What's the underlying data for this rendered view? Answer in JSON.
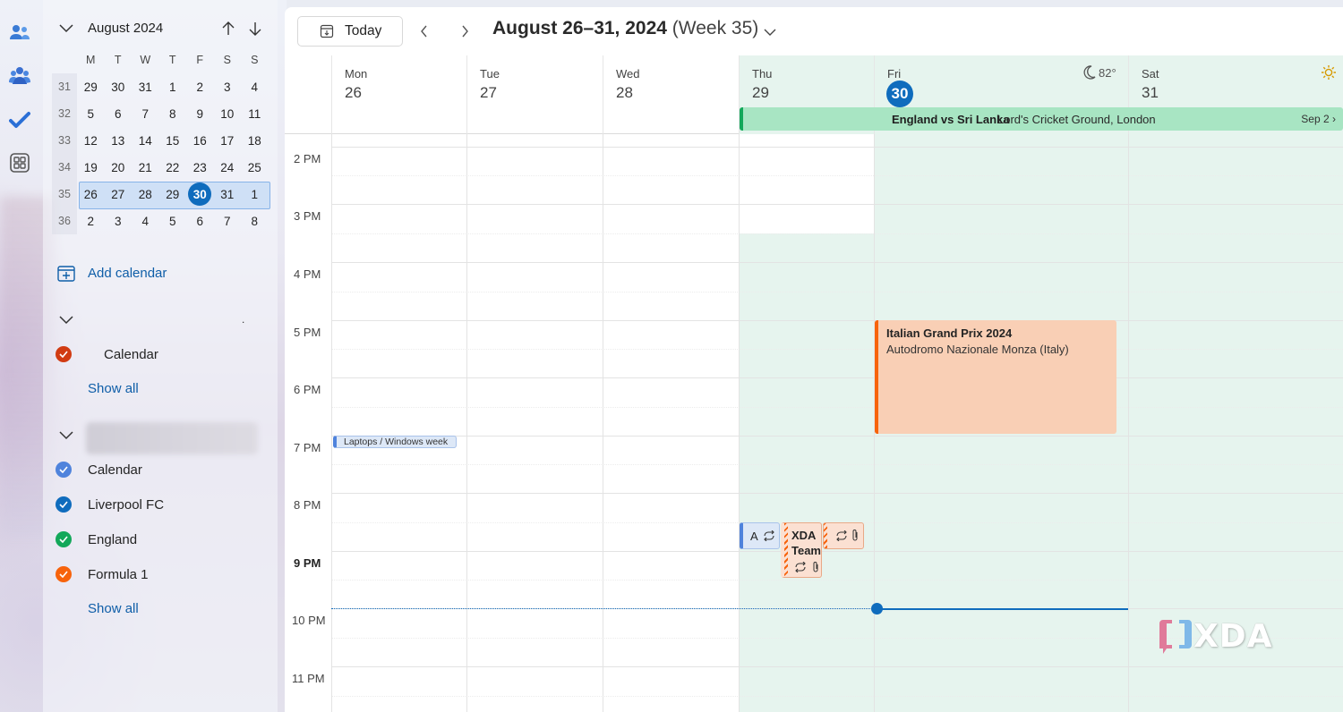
{
  "colors": {
    "accent": "#0f6cbd",
    "green": "#13a85a",
    "orange": "#f7630c",
    "today_bg": "#e6f4ee"
  },
  "rail": {
    "items": [
      "people-icon",
      "groups-icon",
      "todo-icon",
      "apps-icon"
    ]
  },
  "mini_calendar": {
    "title": "August 2024",
    "weekday_headers": [
      "M",
      "T",
      "W",
      "T",
      "F",
      "S",
      "S"
    ],
    "weeks": [
      {
        "num": "31",
        "days": [
          "29",
          "30",
          "31",
          "1",
          "2",
          "3",
          "4"
        ]
      },
      {
        "num": "32",
        "days": [
          "5",
          "6",
          "7",
          "8",
          "9",
          "10",
          "11"
        ]
      },
      {
        "num": "33",
        "days": [
          "12",
          "13",
          "14",
          "15",
          "16",
          "17",
          "18"
        ]
      },
      {
        "num": "34",
        "days": [
          "19",
          "20",
          "21",
          "22",
          "23",
          "24",
          "25"
        ]
      },
      {
        "num": "35",
        "days": [
          "26",
          "27",
          "28",
          "29",
          "30",
          "31",
          "1"
        ]
      },
      {
        "num": "36",
        "days": [
          "2",
          "3",
          "4",
          "5",
          "6",
          "7",
          "8"
        ]
      }
    ],
    "today": "30"
  },
  "sidebar": {
    "add_calendar": "Add calendar",
    "group1": {
      "dot": ".",
      "calendars": [
        {
          "name": "Calendar",
          "color": "#d13b12"
        }
      ],
      "show_all": "Show all"
    },
    "group2": {
      "calendars": [
        {
          "name": "Calendar",
          "color": "#4f83dc"
        },
        {
          "name": "Liverpool FC",
          "color": "#0f6cbd"
        },
        {
          "name": "England",
          "color": "#13a85a"
        },
        {
          "name": "Formula 1",
          "color": "#f7630c"
        }
      ],
      "show_all": "Show all"
    }
  },
  "toolbar": {
    "today": "Today",
    "range_bold": "August 26–31, 2024",
    "range_week": "(Week 35)"
  },
  "days": [
    {
      "name": "Mon",
      "date": "26"
    },
    {
      "name": "Tue",
      "date": "27"
    },
    {
      "name": "Wed",
      "date": "28"
    },
    {
      "name": "Thu",
      "date": "29"
    },
    {
      "name": "Fri",
      "date": "30",
      "today": true,
      "weather": "82°"
    },
    {
      "name": "Sat",
      "date": "31"
    }
  ],
  "all_day_event": {
    "title": "England vs Sri Lanka",
    "location": "Lord's Cricket Ground, London",
    "end": "Sep 2"
  },
  "hours": [
    "2 PM",
    "3 PM",
    "4 PM",
    "5 PM",
    "6 PM",
    "7 PM",
    "8 PM",
    "9 PM",
    "10 PM",
    "11 PM"
  ],
  "events": {
    "italian_gp": {
      "title": "Italian Grand Prix 2024",
      "location": "Autodromo Nazionale Monza (Italy)"
    },
    "laptops": {
      "title": "Laptops / Windows week"
    },
    "thu_a": {
      "title": "A"
    },
    "xda_team": {
      "title": "XDA",
      "title2": "Team"
    }
  },
  "watermark": "XDA"
}
